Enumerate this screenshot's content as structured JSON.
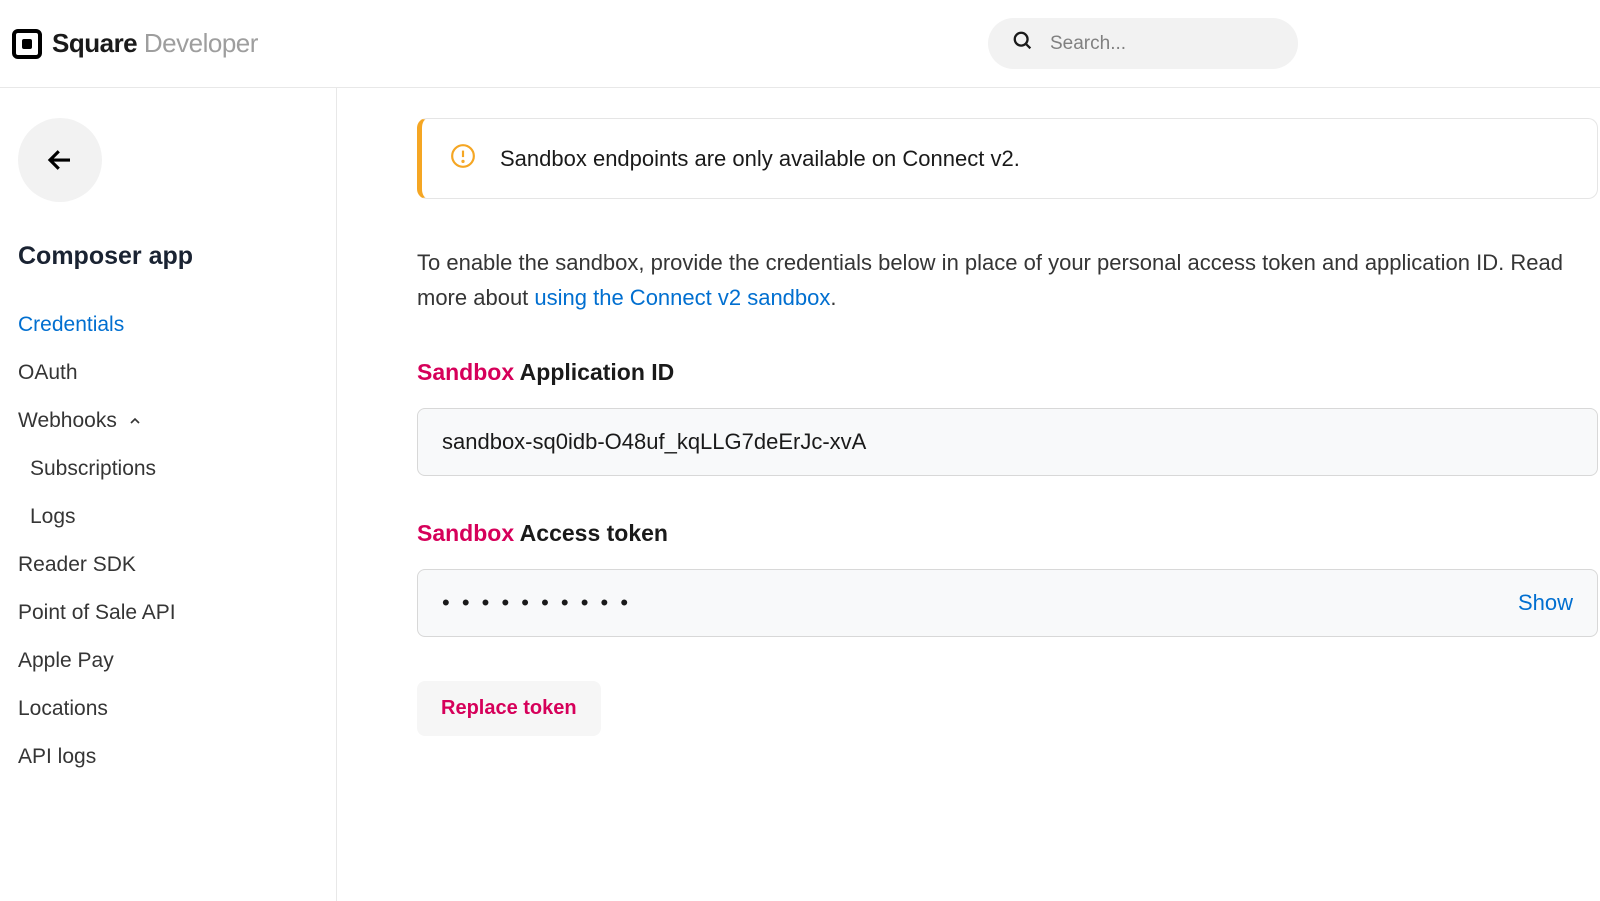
{
  "header": {
    "logo_primary": "Square",
    "logo_secondary": "Developer",
    "search_placeholder": "Search..."
  },
  "sidebar": {
    "app_name": "Composer app",
    "nav": {
      "credentials": "Credentials",
      "oauth": "OAuth",
      "webhooks": "Webhooks",
      "subscriptions": "Subscriptions",
      "logs": "Logs",
      "reader_sdk": "Reader SDK",
      "pos_api": "Point of Sale API",
      "apple_pay": "Apple Pay",
      "locations": "Locations",
      "api_logs": "API logs"
    }
  },
  "main": {
    "alert": "Sandbox endpoints are only available on Connect v2.",
    "description_pre": "To enable the sandbox, provide the credentials below in place of your personal access token and application ID. Read more about ",
    "description_link": "using the Connect v2 sandbox",
    "description_post": ".",
    "app_id": {
      "sandbox_label": "Sandbox",
      "label": " Application ID",
      "value": "sandbox-sq0idb-O48uf_kqLLG7deErJc-xvA"
    },
    "access_token": {
      "sandbox_label": "Sandbox",
      "label": " Access token",
      "masked": "• • • • • • • • • •",
      "show_label": "Show"
    },
    "replace_button": "Replace token"
  }
}
